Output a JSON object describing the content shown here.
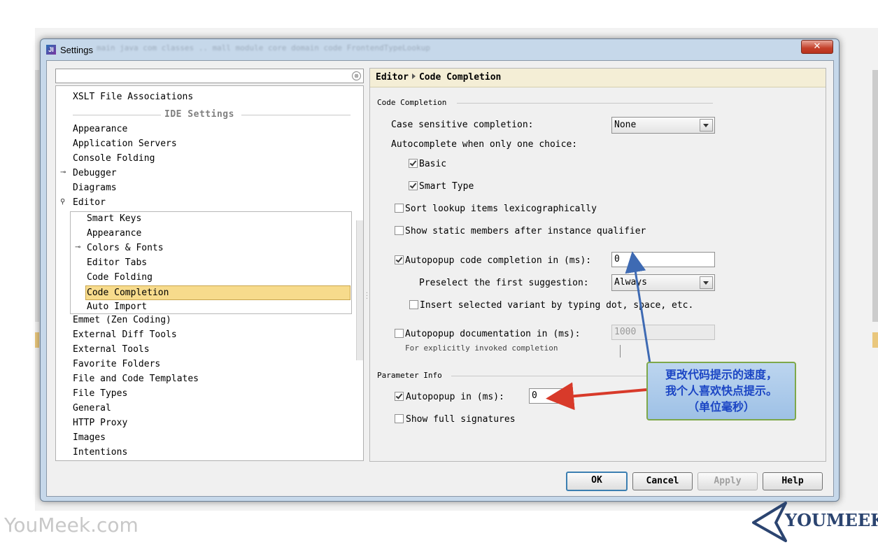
{
  "window": {
    "title": "Settings",
    "close_glyph": "✕",
    "icon_letters": "JI",
    "ghost_tabs": "main  java  com  classes  ..  mall  module  core  domain  code  FrontendTypeLookup"
  },
  "search": {
    "value": "",
    "clear_glyph": "⊗"
  },
  "tree": {
    "items_top": [
      "XSLT File Associations"
    ],
    "section_label": "IDE Settings",
    "items_before_editor": [
      "Appearance",
      "Application Servers",
      "Console Folding",
      "Debugger",
      "Diagrams",
      "Editor"
    ],
    "editor_children": [
      "Smart Keys",
      "Appearance",
      "Colors & Fonts",
      "Editor Tabs",
      "Code Folding",
      "Code Completion",
      "Auto Import"
    ],
    "items_after_editor": [
      "Emmet (Zen Coding)",
      "External Diff Tools",
      "External Tools",
      "Favorite Folders",
      "File and Code Templates",
      "File Types",
      "General",
      "HTTP Proxy",
      "Images",
      "Intentions"
    ],
    "selected": "Code Completion"
  },
  "breadcrumb": {
    "parent": "Editor",
    "current": "Code Completion"
  },
  "code_completion": {
    "group_title": "Code Completion",
    "case_sensitive_label": "Case sensitive completion:",
    "case_sensitive_value": "None",
    "autocomplete_label": "Autocomplete when only one choice:",
    "basic": {
      "label": "Basic",
      "checked": true
    },
    "smart_type": {
      "label": "Smart Type",
      "checked": true
    },
    "sort_lookup": {
      "label": "Sort lookup items lexicographically",
      "checked": false
    },
    "show_static": {
      "label": "Show static members after instance qualifier",
      "checked": false
    },
    "autopopup_completion": {
      "label": "Autopopup code completion in (ms):",
      "checked": true,
      "value": "0"
    },
    "preselect_label": "Preselect the first suggestion:",
    "preselect_value": "Always",
    "insert_variant": {
      "label": "Insert selected variant by typing dot, space, etc.",
      "checked": false
    },
    "autopopup_doc": {
      "label": "Autopopup documentation in (ms):",
      "checked": false,
      "value": "1000",
      "note": "For explicitly invoked completion"
    }
  },
  "parameter_info": {
    "group_title": "Parameter Info",
    "autopopup": {
      "label": "Autopopup in (ms):",
      "checked": true,
      "value": "0"
    },
    "full_signatures": {
      "label": "Show full signatures",
      "checked": false
    }
  },
  "buttons": {
    "ok": "OK",
    "cancel": "Cancel",
    "apply": "Apply",
    "help": "Help"
  },
  "annotation": {
    "line1": "更改代码提示的速度，",
    "line2": "我个人喜欢快点提示。",
    "line3": "（单位毫秒）",
    "text_color": "#1b45c4",
    "arrow_color": "#d83a2a"
  },
  "watermark": {
    "left": "YouMeek.com",
    "right": "YOUMEEK"
  }
}
